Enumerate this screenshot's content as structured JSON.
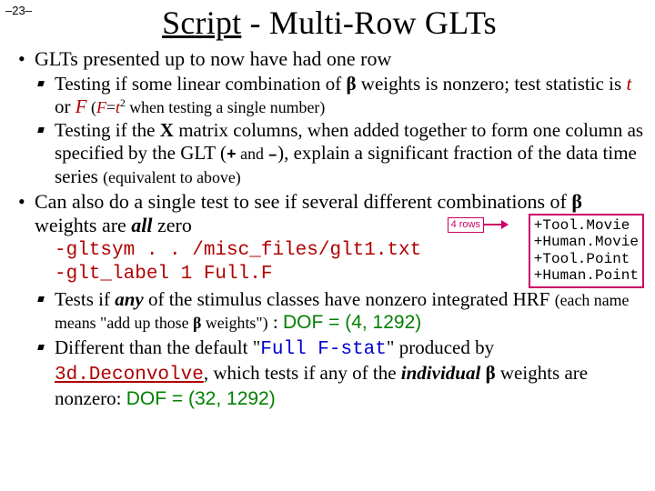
{
  "page_number": "–23–",
  "title": {
    "script": "Script",
    "rest": " - Multi-Row GLTs"
  },
  "bullets": {
    "b1a": "GLTs presented up to now have had one row",
    "b2a_pre": " Testing if some linear combination of ",
    "beta": "β",
    "b2a_mid": " weights is nonzero; test statistic is ",
    "t": "t",
    "or": " or ",
    "F": "F",
    "b2a_paren_open": " (",
    "Feq": "F",
    "eq": "=",
    "t2": "t",
    "sq": "2",
    "b2a_paren_rest": " when testing a single number)",
    "b2b_pre": " Testing if the ",
    "X": "X",
    "b2b_mid1": " matrix columns, when added together to form one column as specified by the GLT (",
    "plus": "+",
    "and": " and ",
    "minus": "–",
    "b2b_mid2": "), explain a significant fraction of the data time series ",
    "b2b_paren": "(equivalent to above)",
    "b1b_pre": "Can also do a single test to see if several different combinations of ",
    "b1b_mid": " weights are ",
    "all": "all",
    "zero": " zero",
    "rows_label": "4 rows",
    "box_l1": "+Tool.Movie",
    "box_l2": "+Human.Movie",
    "box_l3": "+Tool.Point",
    "box_l4": "+Human.Point",
    "cmd1": "-gltsym . . /misc_files/glt1.txt",
    "cmd2": "-glt_label 1 Full.F",
    "b2c_pre": " Tests if ",
    "any": "any",
    "b2c_mid1": " of the stimulus classes have nonzero integrated HRF ",
    "b2c_paren": "(each name means \"add up those ",
    "b2c_paren2": " weights\")",
    "colon1": " : ",
    "dof1": "DOF = (4, 1292)",
    "b2d_pre": " Different than the default \"",
    "fullf": "Full F-stat",
    "b2d_mid1": "\" produced by ",
    "decon": "3d.Deconvolve",
    "b2d_mid2": ", which tests if any of the ",
    "individual": "individual",
    "b2d_mid3": " ",
    "b2d_mid4": " weights are nonzero: ",
    "dof2": "DOF = (32, 1292)"
  }
}
